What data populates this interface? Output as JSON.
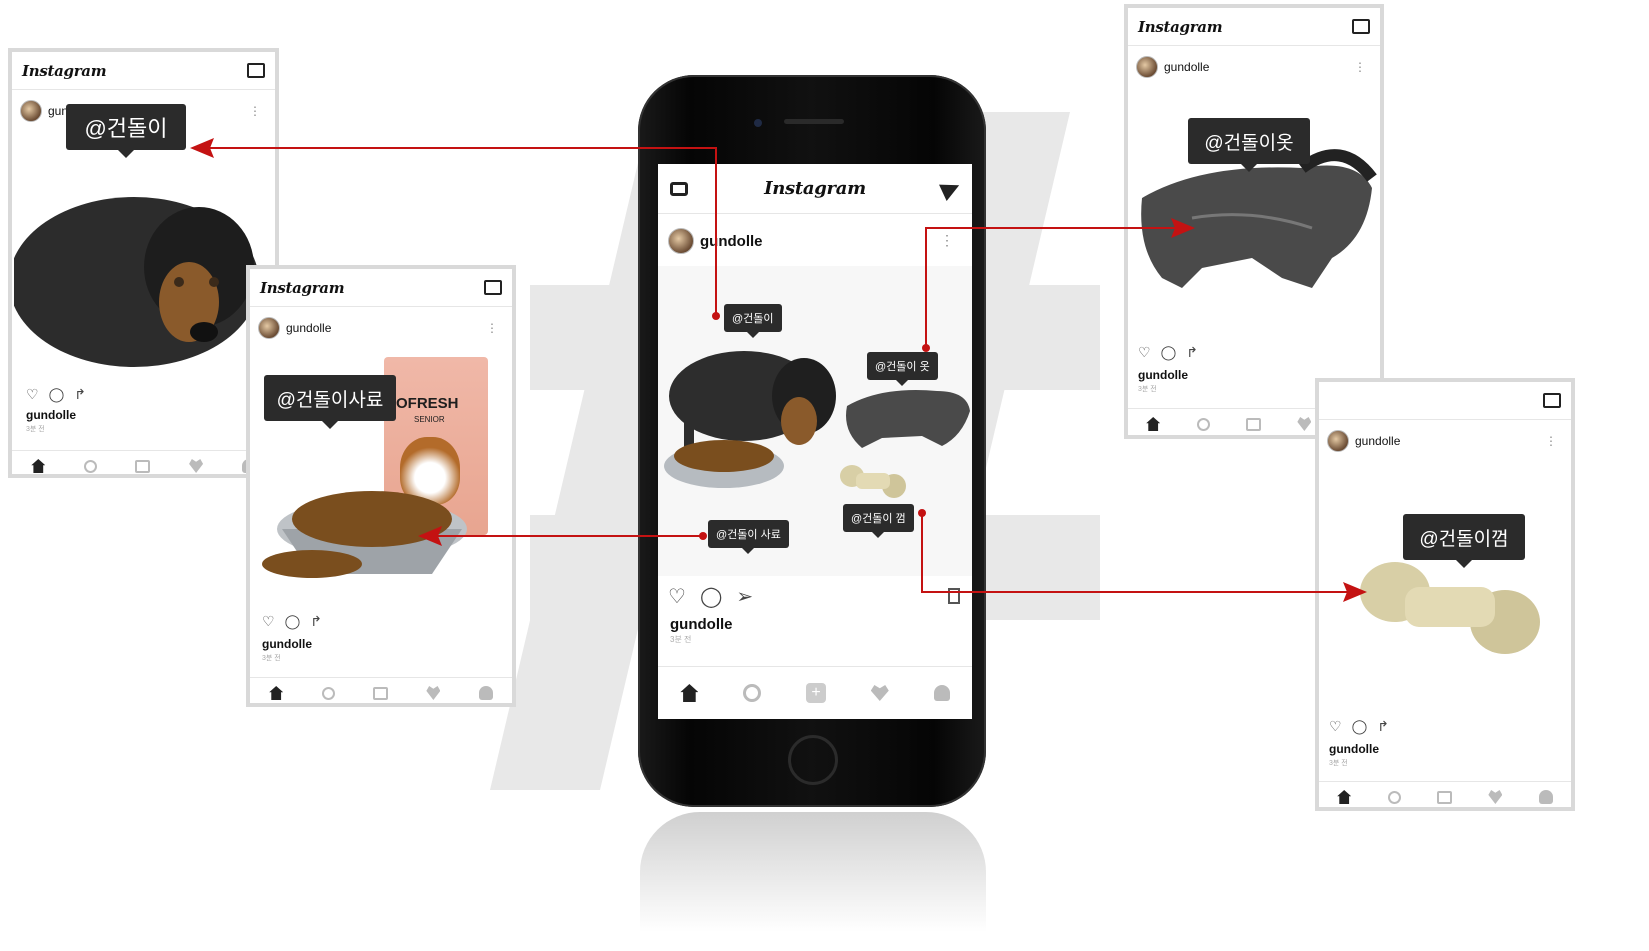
{
  "app": {
    "logo": "Instagram"
  },
  "user": {
    "name": "gundolle",
    "time": "3분 전"
  },
  "center": {
    "tags": [
      "@건돌이",
      "@건돌이 옷",
      "@건돌이 사료",
      "@건돌이 껌"
    ],
    "nav": [
      "home-icon",
      "search-icon",
      "add-icon",
      "heart-icon",
      "profile-icon"
    ]
  },
  "mock_dog": {
    "tag": "@건돌이"
  },
  "mock_food": {
    "tag": "@건돌이사료",
    "package_brand": "OFRESH",
    "package_sub": "SENIOR"
  },
  "mock_coat": {
    "tag": "@건돌이옷"
  },
  "mock_chew": {
    "tag": "@건돌이껌"
  },
  "colors": {
    "arrow": "#c41212",
    "tag_bg": "#2b2b2b",
    "hash_bg": "#e8e8e8"
  }
}
